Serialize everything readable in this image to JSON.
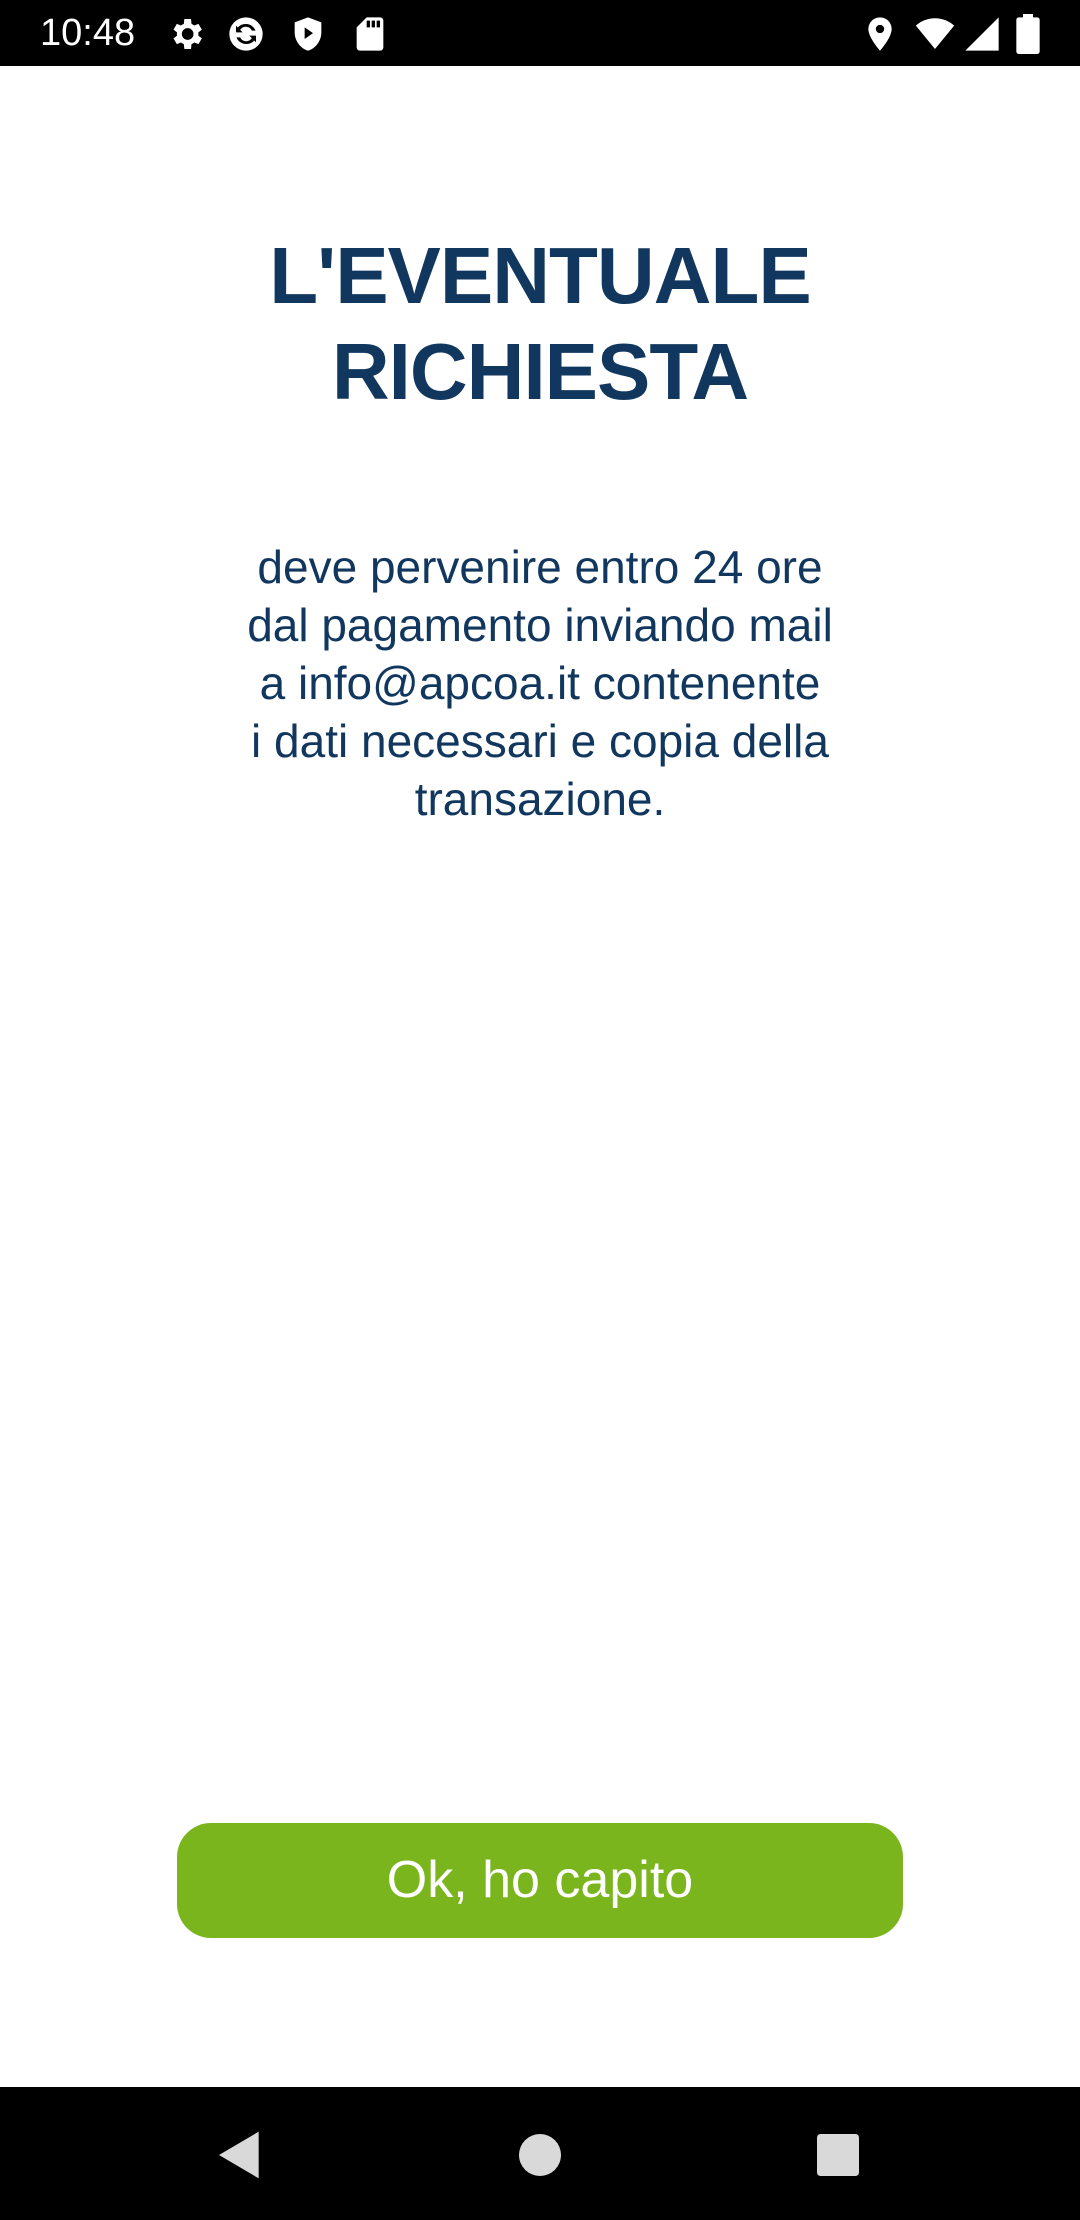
{
  "status_bar": {
    "time": "10:48",
    "left_icons": [
      "gear-icon",
      "sync-icon",
      "shield-play-icon",
      "sd-card-icon"
    ],
    "right_icons": [
      "location-icon",
      "wifi-icon",
      "signal-icon",
      "battery-icon"
    ]
  },
  "content": {
    "title_lines": [
      "L'EVENTUALE",
      "RICHIESTA"
    ],
    "body_lines": [
      "deve pervenire entro 24 ore",
      "dal pagamento inviando mail",
      "a info@apcoa.it contenente",
      "i dati necessari e copia della",
      "transazione."
    ],
    "button_label": "Ok, ho capito"
  },
  "nav_bar": {
    "buttons": [
      "back-icon",
      "home-icon",
      "recents-icon"
    ]
  },
  "colors": {
    "title": "#12375e",
    "button": "#7ab51d",
    "bars": "#000000"
  }
}
